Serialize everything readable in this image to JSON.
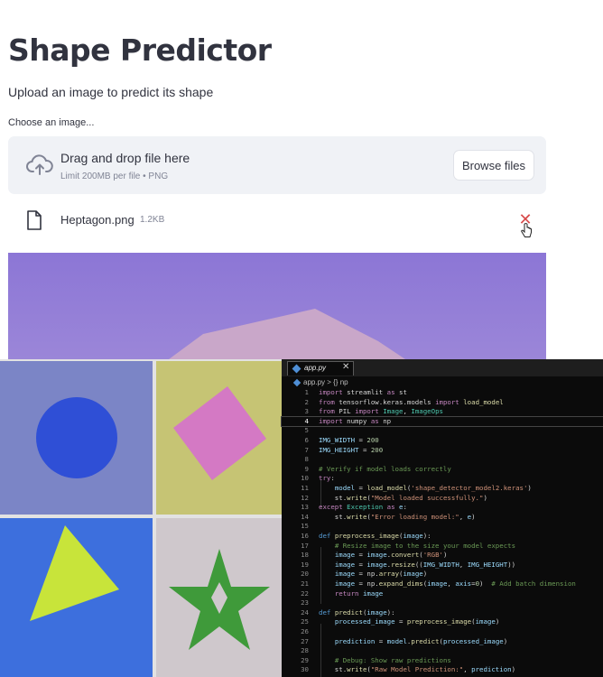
{
  "app": {
    "title": "Shape Predictor",
    "subtitle": "Upload an image to predict its shape",
    "uploader_label": "Choose an image...",
    "dropzone": {
      "main_text": "Drag and drop file here",
      "sub_text": "Limit 200MB per file • PNG",
      "browse_label": "Browse files"
    },
    "uploaded_file": {
      "name": "Heptagon.png",
      "size": "1.2KB"
    }
  },
  "icons": {
    "upload": "cloud-upload-icon",
    "file": "file-icon",
    "remove": "close-icon",
    "cursor": "pointer-cursor-icon"
  },
  "colors": {
    "preview_bg": "#8c76d6",
    "heptagon": "#c7a3c8",
    "remove_x": "#d74b4b"
  },
  "editor": {
    "tab_label": "app.py",
    "tab_close": "✕",
    "breadcrumb": "app.py > {} np",
    "lines": [
      {
        "n": "1",
        "html": "<span class=\"kw\">import</span> streamlit <span class=\"kw\">as</span> st"
      },
      {
        "n": "2",
        "html": "<span class=\"kw\">from</span> tensorflow.keras.models <span class=\"kw\">import</span> <span class=\"fn\">load_model</span>"
      },
      {
        "n": "3",
        "html": "<span class=\"kw\">from</span> PIL <span class=\"kw\">import</span> <span class=\"cls\">Image</span>, <span class=\"cls\">ImageOps</span>"
      },
      {
        "n": "4",
        "html": "<span class=\"kw\">import</span> numpy <span class=\"kw\">as</span> np",
        "current": true
      },
      {
        "n": "5",
        "html": ""
      },
      {
        "n": "6",
        "html": "<span class=\"var\">IMG_WIDTH</span> = <span class=\"num\">200</span>"
      },
      {
        "n": "7",
        "html": "<span class=\"var\">IMG_HEIGHT</span> = <span class=\"num\">200</span>"
      },
      {
        "n": "8",
        "html": ""
      },
      {
        "n": "9",
        "html": "<span class=\"cm\"># Verify if model loads correctly</span>"
      },
      {
        "n": "10",
        "html": "<span class=\"kw\">try</span>:"
      },
      {
        "n": "11",
        "html": "    <span class=\"var\">model</span> = <span class=\"fn\">load_model</span>(<span class=\"str\">'shape_detector_model2.keras'</span>)"
      },
      {
        "n": "12",
        "html": "    st.<span class=\"fn\">write</span>(<span class=\"str\">\"Model loaded successfully.\"</span>)"
      },
      {
        "n": "13",
        "html": "<span class=\"kw\">except</span> <span class=\"cls\">Exception</span> <span class=\"kw\">as</span> <span class=\"var\">e</span>:"
      },
      {
        "n": "14",
        "html": "    st.<span class=\"fn\">write</span>(<span class=\"str\">\"Error loading model:\"</span>, <span class=\"var\">e</span>)"
      },
      {
        "n": "15",
        "html": ""
      },
      {
        "n": "16",
        "html": "<span class=\"kw2\">def</span> <span class=\"fn\">preprocess_image</span>(<span class=\"var\">image</span>):"
      },
      {
        "n": "17",
        "html": "    <span class=\"cm\"># Resize image to the size your model expects</span>"
      },
      {
        "n": "18",
        "html": "    <span class=\"var\">image</span> = <span class=\"var\">image</span>.<span class=\"fn\">convert</span>(<span class=\"str\">'RGB'</span>)"
      },
      {
        "n": "19",
        "html": "    <span class=\"var\">image</span> = <span class=\"var\">image</span>.<span class=\"fn\">resize</span>((<span class=\"var\">IMG_WIDTH</span>, <span class=\"var\">IMG_HEIGHT</span>))"
      },
      {
        "n": "20",
        "html": "    <span class=\"var\">image</span> = np.<span class=\"fn\">array</span>(<span class=\"var\">image</span>)"
      },
      {
        "n": "21",
        "html": "    <span class=\"var\">image</span> = np.<span class=\"fn\">expand_dims</span>(<span class=\"var\">image</span>, <span class=\"var\">axis</span>=<span class=\"num\">0</span>)  <span class=\"cm\"># Add batch dimension</span>"
      },
      {
        "n": "22",
        "html": "    <span class=\"kw\">return</span> <span class=\"var\">image</span>"
      },
      {
        "n": "23",
        "html": ""
      },
      {
        "n": "24",
        "html": "<span class=\"kw2\">def</span> <span class=\"fn\">predict</span>(<span class=\"var\">image</span>):"
      },
      {
        "n": "25",
        "html": "    <span class=\"var\">processed_image</span> = <span class=\"fn\">preprocess_image</span>(<span class=\"var\">image</span>)"
      },
      {
        "n": "26",
        "html": ""
      },
      {
        "n": "27",
        "html": "    <span class=\"var\">prediction</span> = <span class=\"var\">model</span>.<span class=\"fn\">predict</span>(<span class=\"var\">processed_image</span>)"
      },
      {
        "n": "28",
        "html": ""
      },
      {
        "n": "29",
        "html": "    <span class=\"cm\"># Debug: Show raw predictions</span>"
      },
      {
        "n": "30",
        "html": "    st.<span class=\"fn\">write</span>(<span class=\"str\">\"Raw Model Prediction:\"</span>, <span class=\"var\">prediction</span>)"
      }
    ]
  }
}
